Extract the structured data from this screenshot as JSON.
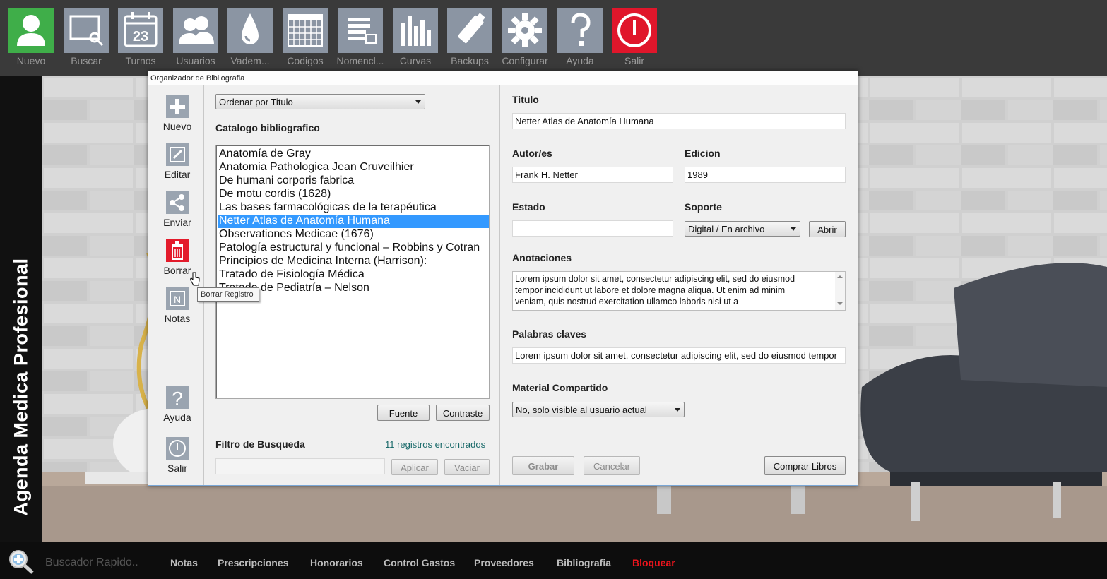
{
  "toolbar": {
    "items": [
      {
        "label": "Nuevo",
        "icon": "user-icon",
        "color": "#3fae49"
      },
      {
        "label": "Buscar",
        "icon": "search-screen-icon",
        "color": "#8b95a3"
      },
      {
        "label": "Turnos",
        "icon": "calendar-icon",
        "color": "#8b95a3",
        "calendar_day": "23"
      },
      {
        "label": "Usuarios",
        "icon": "users-icon",
        "color": "#8b95a3"
      },
      {
        "label": "Vadem...",
        "icon": "drop-icon",
        "color": "#8b95a3"
      },
      {
        "label": "Codigos",
        "icon": "grid-icon",
        "color": "#8b95a3"
      },
      {
        "label": "Nomencl...",
        "icon": "list-icon",
        "color": "#8b95a3"
      },
      {
        "label": "Curvas",
        "icon": "bar-chart-icon",
        "color": "#8b95a3"
      },
      {
        "label": "Backups",
        "icon": "usb-drive-icon",
        "color": "#8b95a3"
      },
      {
        "label": "Configurar",
        "icon": "gear-icon",
        "color": "#8b95a3"
      },
      {
        "label": "Ayuda",
        "icon": "question-icon",
        "color": "#8b95a3"
      },
      {
        "label": "Salir",
        "icon": "power-icon",
        "color": "#e0162b"
      }
    ]
  },
  "app_title": "Agenda Medica Profesional",
  "window": {
    "title": "Organizador de Bibliografia",
    "side": {
      "nuevo": "Nuevo",
      "editar": "Editar",
      "enviar": "Enviar",
      "borrar": "Borrar",
      "notas": "Notas",
      "ayuda": "Ayuda",
      "salir": "Salir",
      "notas_letter": "N",
      "help_glyph": "?"
    },
    "tooltip": "Borrar Registro",
    "sort_combo": "Ordenar por Titulo",
    "catalog_label": "Catalogo bibliografico",
    "books": [
      "Anatomía de Gray",
      "Anatomia Pathologica Jean Cruveilhier",
      "De humani corporis fabrica",
      "De motu cordis (1628)",
      "Las bases farmacológicas de la terapéutica",
      "Netter Atlas de Anatomía Humana",
      "Observationes Medicae (1676)",
      "Patología estructural y funcional – Robbins y Cotran",
      "Principios de Medicina Interna (Harrison):",
      "Tratado de Fisiología Médica",
      "Tratado de Pediatría – Nelson"
    ],
    "selected_index": 5,
    "fuente_btn": "Fuente",
    "contraste_btn": "Contraste",
    "filtro_label": "Filtro de Busqueda",
    "records_found": "11 registros encontrados",
    "filtro_value": "",
    "aplicar_btn": "Aplicar",
    "vaciar_btn": "Vaciar",
    "titulo_label": "Titulo",
    "titulo_value": "Netter Atlas de Anatomía Humana",
    "autor_label": "Autor/es",
    "autor_value": "Frank H. Netter",
    "edicion_label": "Edicion",
    "edicion_value": "1989",
    "estado_label": "Estado",
    "estado_value": "",
    "soporte_label": "Soporte",
    "soporte_value": "Digital / En archivo",
    "abrir_btn": "Abrir",
    "anotaciones_label": "Anotaciones",
    "anotaciones_lines": [
      "Lorem ipsum dolor sit amet, consectetur adipiscing elit, sed do eiusmod",
      "tempor incididunt ut labore et dolore magna aliqua. Ut enim ad minim",
      "veniam, quis nostrud exercitation ullamco laboris nisi ut a"
    ],
    "palabras_label": "Palabras claves",
    "palabras_value": "Lorem ipsum dolor sit amet, consectetur adipiscing elit, sed do eiusmod tempor",
    "material_label": "Material Compartido",
    "material_value": "No, solo visible al usuario actual",
    "grabar_btn": "Grabar",
    "cancelar_btn": "Cancelar",
    "comprar_btn": "Comprar Libros"
  },
  "bottom": {
    "search_placeholder": "Buscador Rapido..",
    "links": [
      "Notas",
      "Prescripciones",
      "Honorarios",
      "Control Gastos",
      "Proveedores",
      "Bibliografia"
    ],
    "lock_link": "Bloquear",
    "lock_color": "#e8141c"
  }
}
